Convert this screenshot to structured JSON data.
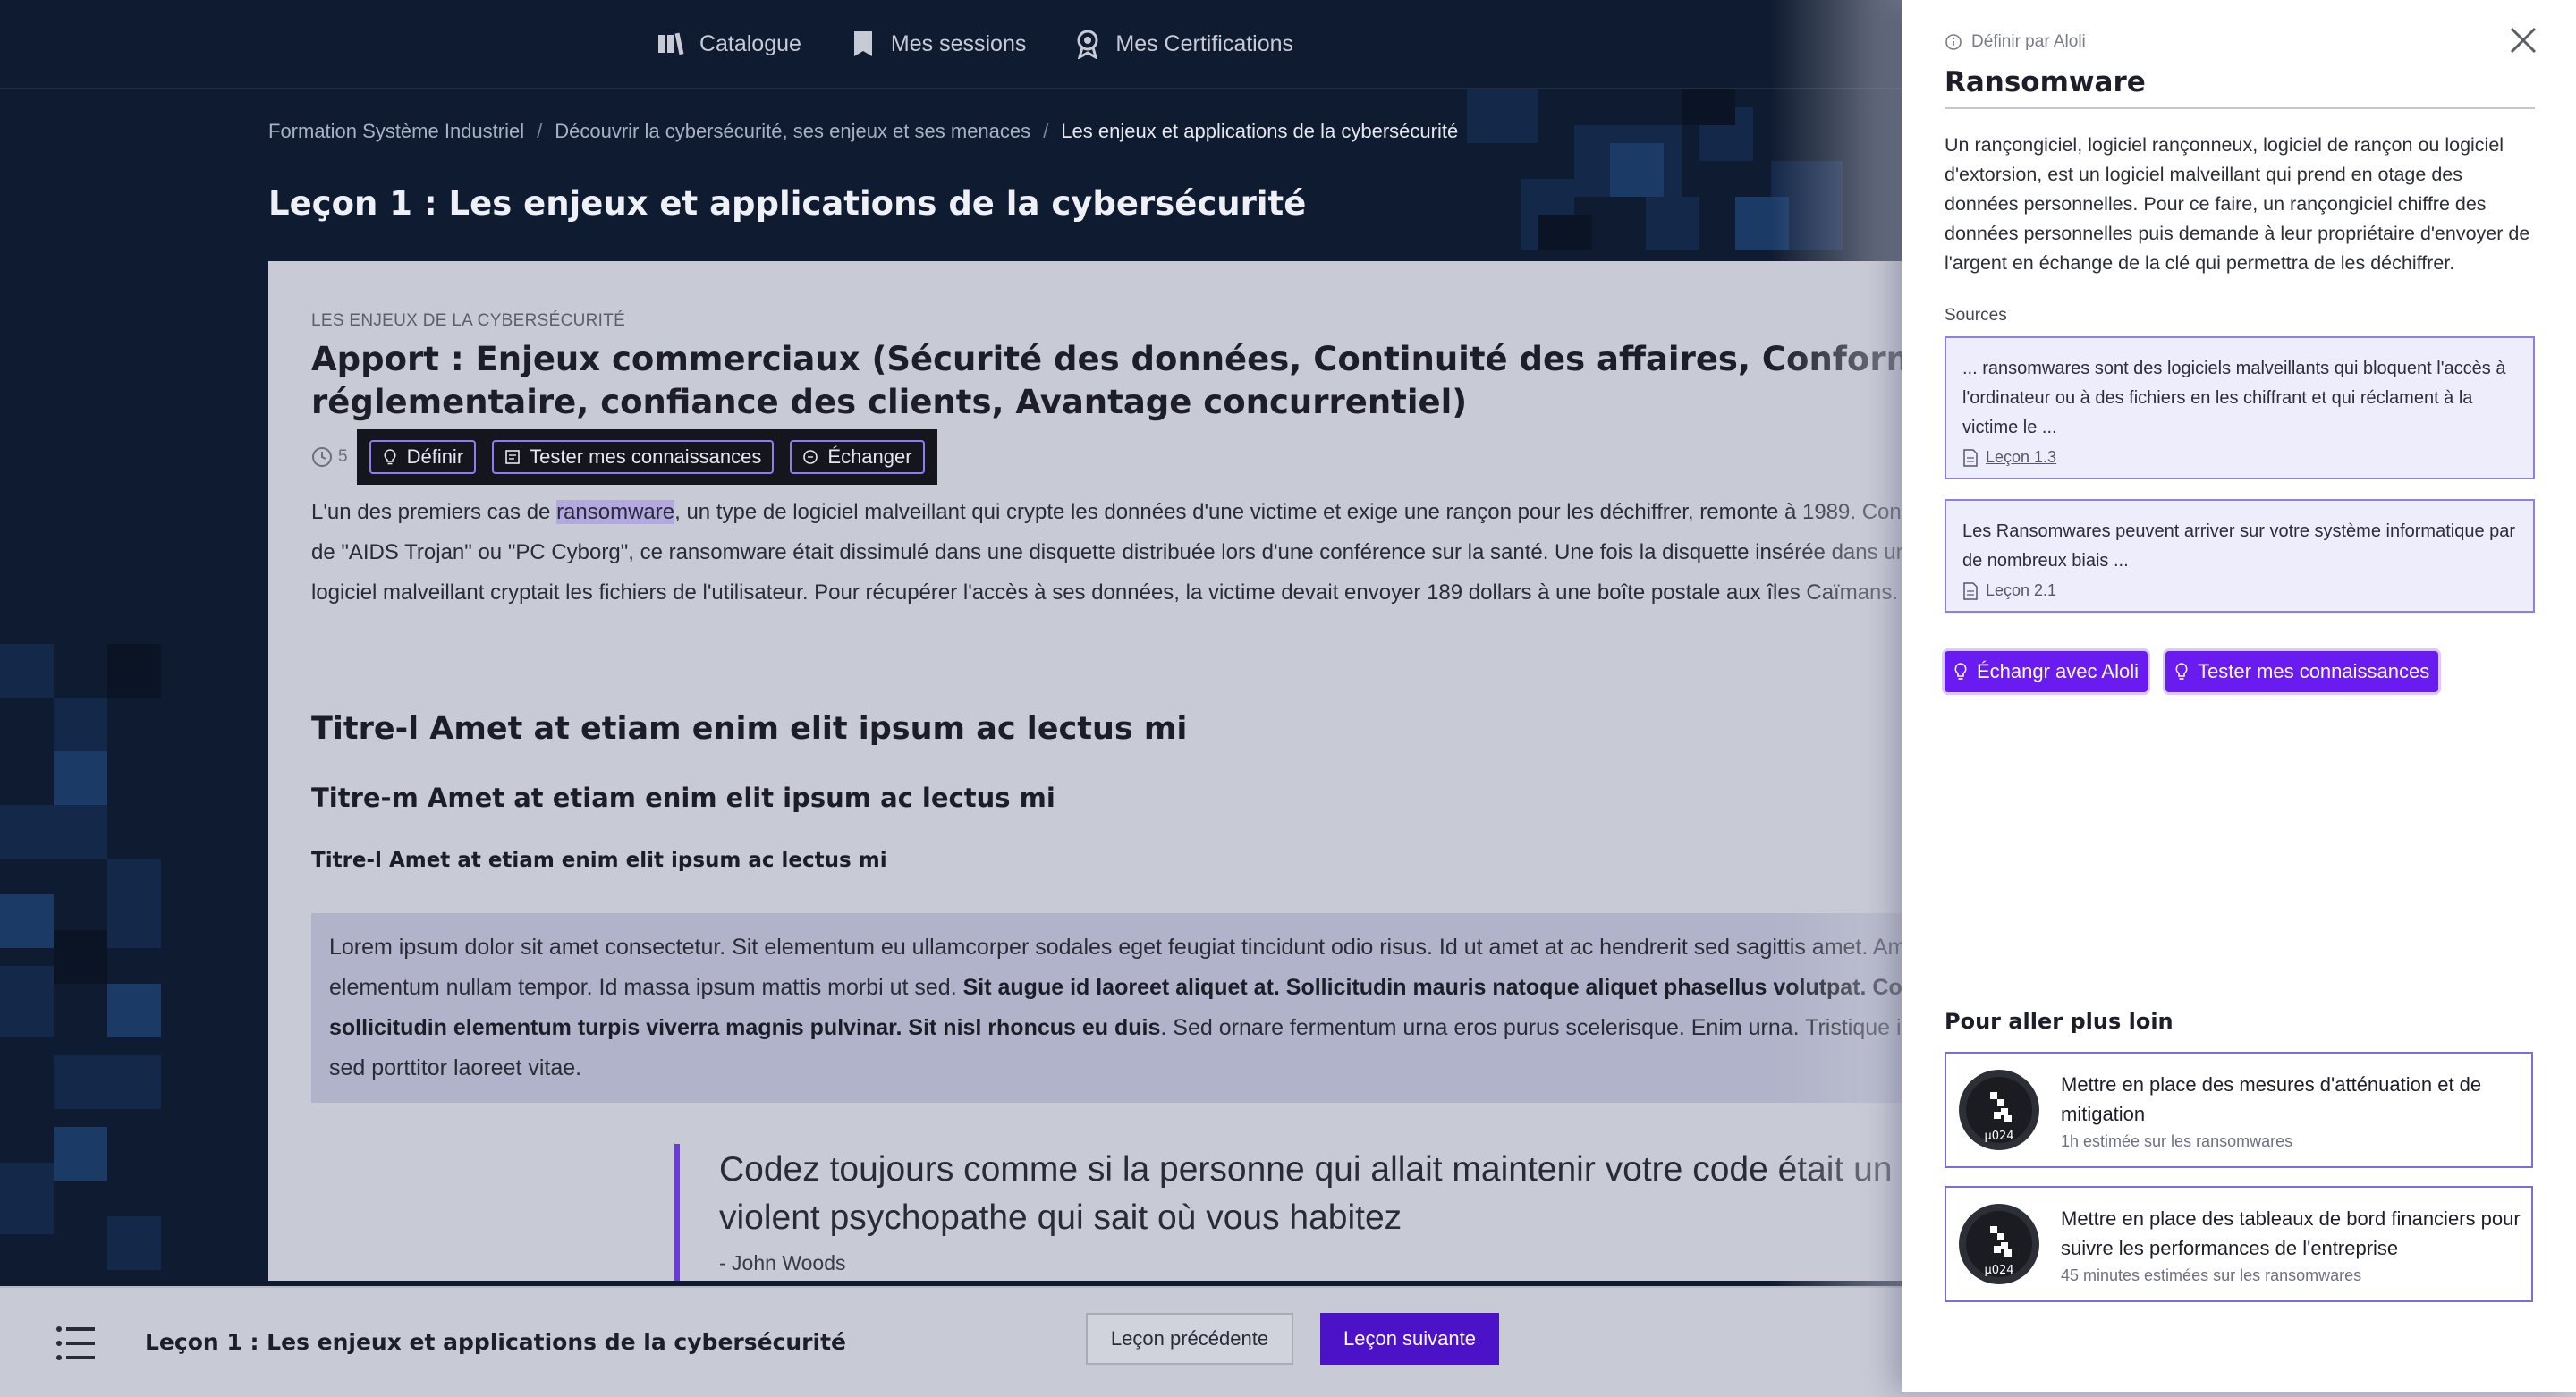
{
  "topnav": {
    "items": [
      {
        "label": "Catalogue",
        "icon": "catalog-icon"
      },
      {
        "label": "Mes sessions",
        "icon": "bookmark-icon"
      },
      {
        "label": "Mes Certifications",
        "icon": "award-icon"
      }
    ]
  },
  "breadcrumb": {
    "items": [
      "Formation Système Industriel",
      "Découvrir la cybersécurité, ses enjeux et ses menaces",
      "Les enjeux et applications de la cybersécurité"
    ],
    "separator": "/"
  },
  "lesson": {
    "title": "Leçon 1 : Les enjeux et applications de la cybersécurité"
  },
  "content": {
    "kicker": "LES ENJEUX DE LA CYBERSÉCURITÉ",
    "heading": "Apport : Enjeux commerciaux (Sécurité des données, Continuité des affaires, Conformité réglementaire, confiance des clients, Avantage concurrentiel)",
    "duration": "5",
    "toolbar": {
      "define": "Définir",
      "test": "Tester mes connaissances",
      "exchange": "Échanger"
    },
    "para_before": "L'un des premiers cas de ",
    "para_highlight": "ransomware",
    "para_after": ", un type de logiciel malveillant qui crypte les données d'une victime et exige une rançon pour les déchiffrer, remonte à 1989. Connu sous le nom de \"AIDS Trojan\" ou \"PC Cyborg\", ce ransomware était dissimulé dans une disquette distribuée lors d'une conférence sur la santé. Une fois la disquette insérée dans un ordinateur, le logiciel malveillant cryptait les fichiers de l'utilisateur. Pour récupérer l'accès à ses données, la victime devait envoyer 189 dollars à une boîte postale aux îles Caïmans.",
    "h_large": "Titre-l Amet at etiam enim elit ipsum ac lectus mi",
    "h_medium": "Titre-m Amet at etiam enim elit ipsum ac lectus mi",
    "h_small": "Titre-l Amet at etiam enim elit ipsum ac lectus mi",
    "callout_start": "Lorem ipsum dolor sit amet consectetur. Sit elementum eu ullamcorper sodales eget feugiat tincidunt odio risus. Id ut amet at ac hendrerit sed sagittis amet. Amet dolor sit elementum nullam tempor. Id massa ipsum mattis morbi ut sed. ",
    "callout_bold": "Sit augue id laoreet aliquet at. Sollicitudin mauris natoque aliquet phasellus volutpat. Consectetur sollicitudin elementum turpis viverra magnis pulvinar. Sit nisl rhoncus eu duis",
    "callout_end": ". Sed ornare fermentum urna eros purus scelerisque. Enim urna. Tristique integer sagittis sed porttitor laoreet vitae.",
    "quote_text": "Codez toujours comme si la personne qui allait maintenir votre code était un violent psychopathe qui sait où vous habitez",
    "quote_author": "- John Woods"
  },
  "footer": {
    "title": "Leçon 1 : Les enjeux et applications de la cybersécurité",
    "prev_label": "Leçon précédente",
    "next_label": "Leçon suivante"
  },
  "panel": {
    "defined_by": "Définir par Aloli",
    "term": "Ransomware",
    "definition": "Un rançongiciel, logiciel rançonneux, logiciel de rançon ou logiciel d'extorsion, est un logiciel malveillant qui prend en otage des données personnelles. Pour ce faire, un rançongiciel chiffre des données personnelles puis demande à leur propriétaire d'envoyer de l'argent en échange de la clé qui permettra de les déchiffrer.",
    "sources_label": "Sources",
    "sources": [
      {
        "text": "... ransomwares sont des logiciels malveillants qui bloquent l'accès à l'ordinateur ou à des fichiers en les chiffrant et qui réclament à la victime le ...",
        "link": "Leçon 1.3"
      },
      {
        "text": "Les Ransomwares peuvent arriver sur votre système informatique par de nombreux biais ...",
        "link": "Leçon 2.1"
      }
    ],
    "actions": {
      "exchange": "Échangr avec Aloli",
      "test": "Tester mes connaissances"
    },
    "further_label": "Pour aller plus loin",
    "recommendations": [
      {
        "title": "Mettre en place des mesures d'atténuation et de mitigation",
        "subtitle": "1h estimée sur les ransomwares",
        "badge": "µ024"
      },
      {
        "title": "Mettre en place des tableaux de bord financiers pour suivre les performances de l'entreprise",
        "subtitle": "45 minutes estimées sur les ransomwares",
        "badge": "µ024"
      }
    ]
  },
  "colors": {
    "accent": "#6a1bf0",
    "accent_dark": "#4b12c8",
    "background": "#0e1a2e",
    "content_bg": "#c8cad6"
  }
}
